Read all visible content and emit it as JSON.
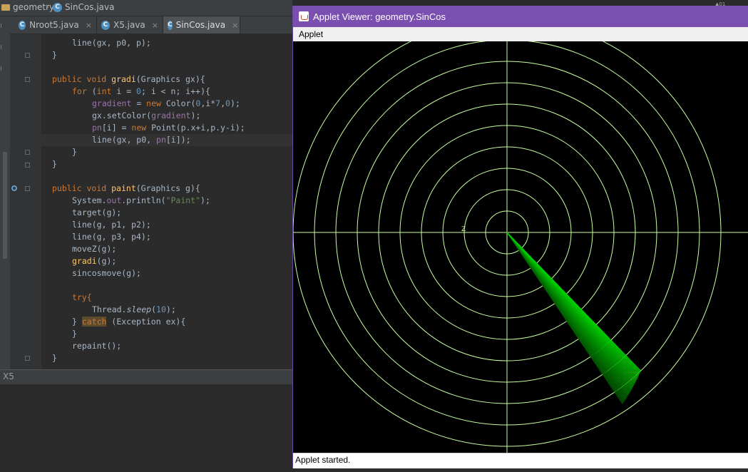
{
  "breadcrumb": {
    "project": "geometry",
    "file": "SinCos.java"
  },
  "tabs": [
    {
      "label": "Nroot5.java",
      "close": "×"
    },
    {
      "label": "X5.java",
      "close": "×"
    },
    {
      "label": "SinCos.java",
      "close": "×"
    }
  ],
  "bottom_bar": {
    "label": "X5"
  },
  "code_lines": {
    "l1": "line(gx, p0, p);",
    "l2": "}",
    "l4": "public void gradi(Graphics gx){",
    "l5": "for (int i = 0; i < n; i++){",
    "l6": "gradient = new Color(0,i*7,0);",
    "l7": "gx.setColor(gradient);",
    "l8": "pn[i] = new Point(p.x+i,p.y-i);",
    "l9": "line(gx, p0, pn[i]);",
    "l10": "}",
    "l11": "}",
    "l13": "public void paint(Graphics g){",
    "l14": "System.out.println(\"Paint\");",
    "l15": "target(g);",
    "l16": "line(g, p1, p2);",
    "l17": "line(g, p3, p4);",
    "l18": "moveZ(g);",
    "l19": "gradi(g);",
    "l20": "sincosmove(g);",
    "l22": "try{",
    "l23": "Thread.sleep(10);",
    "l24": "} catch (Exception ex){",
    "l25": "}",
    "l26": "repaint();",
    "l27": "}"
  },
  "applet": {
    "title": "Applet Viewer: geometry.SinCos",
    "menu": "Applet",
    "status": "Applet started.",
    "radar": {
      "rings": 10,
      "ring_color": "#c8ffa0",
      "crosshair_color": "#c8ffa0",
      "beam_color": "#00b000",
      "beam_start_direction_deg": 56,
      "beam_end_direction_deg": 46
    }
  },
  "corner_text": "▲01"
}
